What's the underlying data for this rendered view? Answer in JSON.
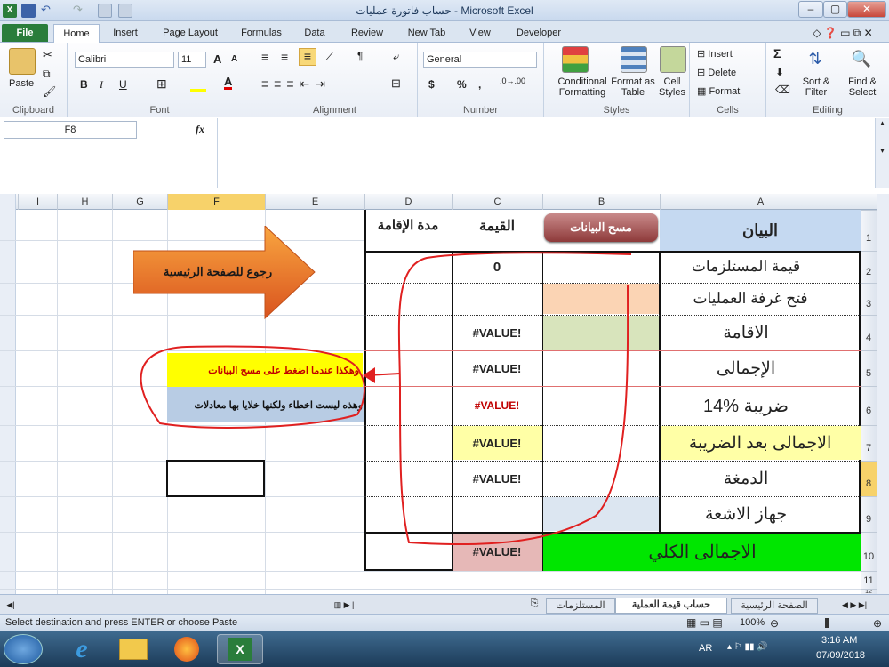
{
  "window": {
    "title": "حساب فاتورة عمليات  -  Microsoft Excel"
  },
  "tabs": [
    "File",
    "Home",
    "Insert",
    "Page Layout",
    "Formulas",
    "Data",
    "Review",
    "New Tab",
    "View",
    "Developer"
  ],
  "ribbon": {
    "clipboard": {
      "paste": "Paste",
      "label": "Clipboard"
    },
    "font": {
      "name": "Calibri",
      "size": "11",
      "label": "Font",
      "bold": "B",
      "italic": "I",
      "underline": "U",
      "grow": "A",
      "shrink": "A"
    },
    "alignment": {
      "label": "Alignment"
    },
    "number": {
      "format": "General",
      "label": "Number",
      "currency": "$",
      "percent": "%",
      "comma": ","
    },
    "styles": {
      "conditional": "Conditional Formatting",
      "format_table": "Format as Table",
      "cell_styles": "Cell Styles",
      "label": "Styles"
    },
    "cells": {
      "insert": "Insert",
      "delete": "Delete",
      "format": "Format",
      "label": "Cells"
    },
    "editing": {
      "sum": "Σ",
      "sort": "Sort & Filter",
      "find": "Find & Select",
      "label": "Editing"
    }
  },
  "formula_bar": {
    "name_box": "F8",
    "fx": "fx",
    "value": ""
  },
  "columns": [
    "I",
    "H",
    "G",
    "F",
    "E",
    "D",
    "C",
    "B",
    "A"
  ],
  "rows": [
    "1",
    "2",
    "3",
    "4",
    "5",
    "6",
    "7",
    "8",
    "9",
    "10",
    "11",
    "12"
  ],
  "sheet": {
    "headers": {
      "a1": "البيان",
      "b1_button": "مسح البيانات",
      "c1": "القيمة",
      "d1": "مدة الإقامة"
    },
    "labels": [
      "قيمة المستلزمات",
      "فتح غرفة العمليات",
      "الاقامة",
      "الإجمالى",
      "ضريبة %14",
      "الاجمالى بعد الضريبة",
      "الدمغة",
      "جهاز الاشعة"
    ],
    "values": [
      "0",
      "",
      "#VALUE!",
      "#VALUE!",
      "#VALUE!",
      "#VALUE!",
      "#VALUE!",
      ""
    ],
    "total_label": "الاجمالى الكلي",
    "total_value": "#VALUE!",
    "arrow_text": "رجوع للصفحة الرئيسية",
    "note1": "وهكذا عندما اضغط على مسح البيانات",
    "note2": "وهذه ليست اخطاء ولكنها خلايا بها معادلات"
  },
  "sheet_tabs": [
    "الصفحة الرئيسية",
    "حساب قيمة العملية",
    "المستلزمات"
  ],
  "status": {
    "message": "Select destination and press ENTER or choose Paste",
    "zoom": "100%"
  },
  "taskbar": {
    "lang": "AR",
    "time": "3:16 AM",
    "date": "07/09/2018"
  },
  "colors": {
    "excel_green": "#2a7d3b",
    "header_blue": "#c5d9f1",
    "total_green": "#00e600",
    "note_yellow": "#ffff00",
    "peach": "#fbd4b4",
    "light_green": "#d8e4bc",
    "pink": "#e6b8b7",
    "arrow_orange": "#f7901e",
    "annot_red": "#e02020"
  }
}
